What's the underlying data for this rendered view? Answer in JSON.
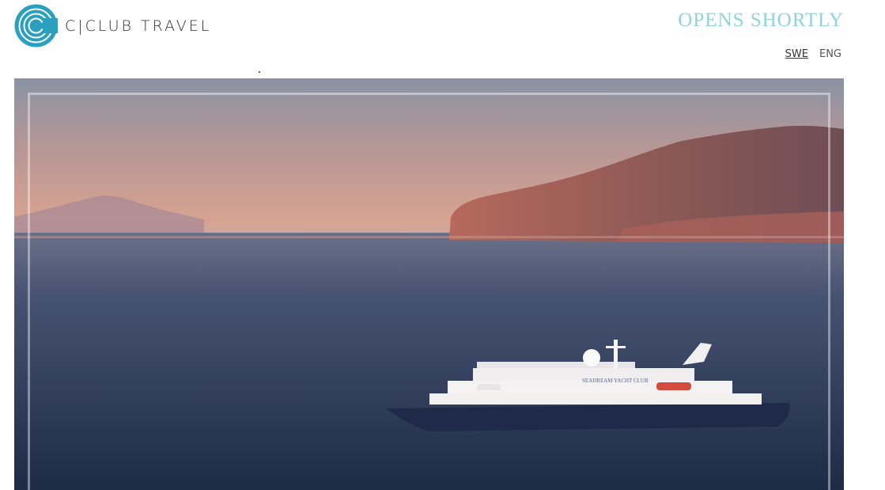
{
  "header": {
    "logo_text": "C|CLUB TRAVEL",
    "headline": "OPENS SHORTLY"
  },
  "language": {
    "options": [
      {
        "label": "SWE",
        "active": true
      },
      {
        "label": "ENG",
        "active": false
      }
    ]
  },
  "hero": {
    "ship_name": "SEADREAM YACHT CLUB"
  },
  "colors": {
    "accent": "#8fd3dd",
    "logo_blue": "#2a9fbe",
    "sea": "#2b3751",
    "sky_top": "#8e96a5",
    "sky_horizon": "#d69a8a"
  },
  "icons": {
    "logo_mark": "c-circle-logo-icon"
  }
}
